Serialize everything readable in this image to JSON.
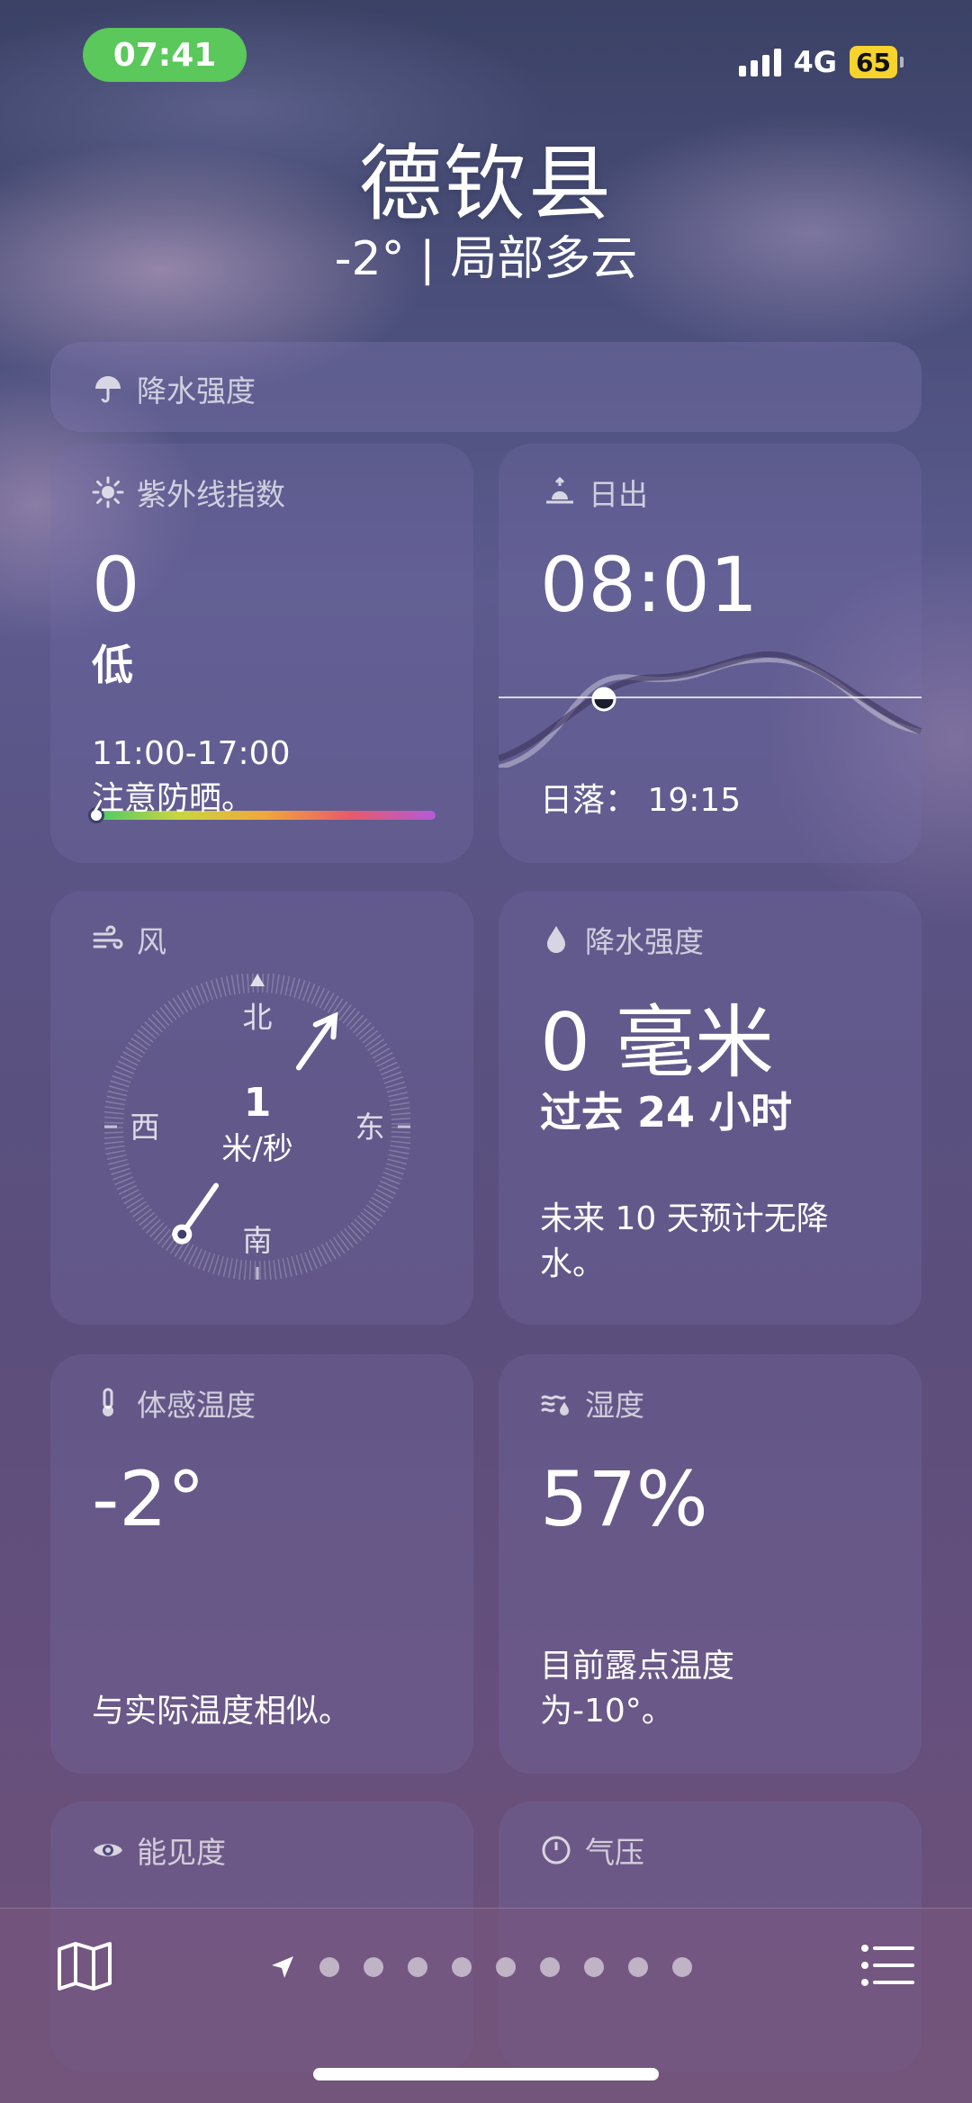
{
  "status": {
    "time": "07:41",
    "network": "4G",
    "battery": "65"
  },
  "header": {
    "city": "德钦县",
    "summary": "-2° | 局部多云"
  },
  "top_strip": {
    "title": "降水强度"
  },
  "uv": {
    "title": "紫外线指数",
    "value": "0",
    "level": "低",
    "period": "11:00-17:00",
    "advice": "注意防晒。",
    "level_fraction": 0.0
  },
  "sunrise": {
    "title": "日出",
    "time": "08:01",
    "sunset": "日落： 19:15"
  },
  "wind": {
    "title": "风",
    "north": "北",
    "south": "南",
    "east": "东",
    "west": "西",
    "speed": "1",
    "unit": "米/秒",
    "direction_deg": 35
  },
  "precip": {
    "title": "降水强度",
    "amount": "0 毫米",
    "period": "过去 24 小时",
    "note": "未来 10 天预计无降水。"
  },
  "feels": {
    "title": "体感温度",
    "value": "-2°",
    "note": "与实际温度相似。"
  },
  "humidity": {
    "title": "湿度",
    "value": "57%",
    "note": "目前露点温度为-10°。"
  },
  "visibility": {
    "title": "能见度"
  },
  "pressure": {
    "title": "气压"
  },
  "bottom": {
    "map_icon": "map-icon",
    "list_icon": "list-icon",
    "page_dots": 9
  }
}
